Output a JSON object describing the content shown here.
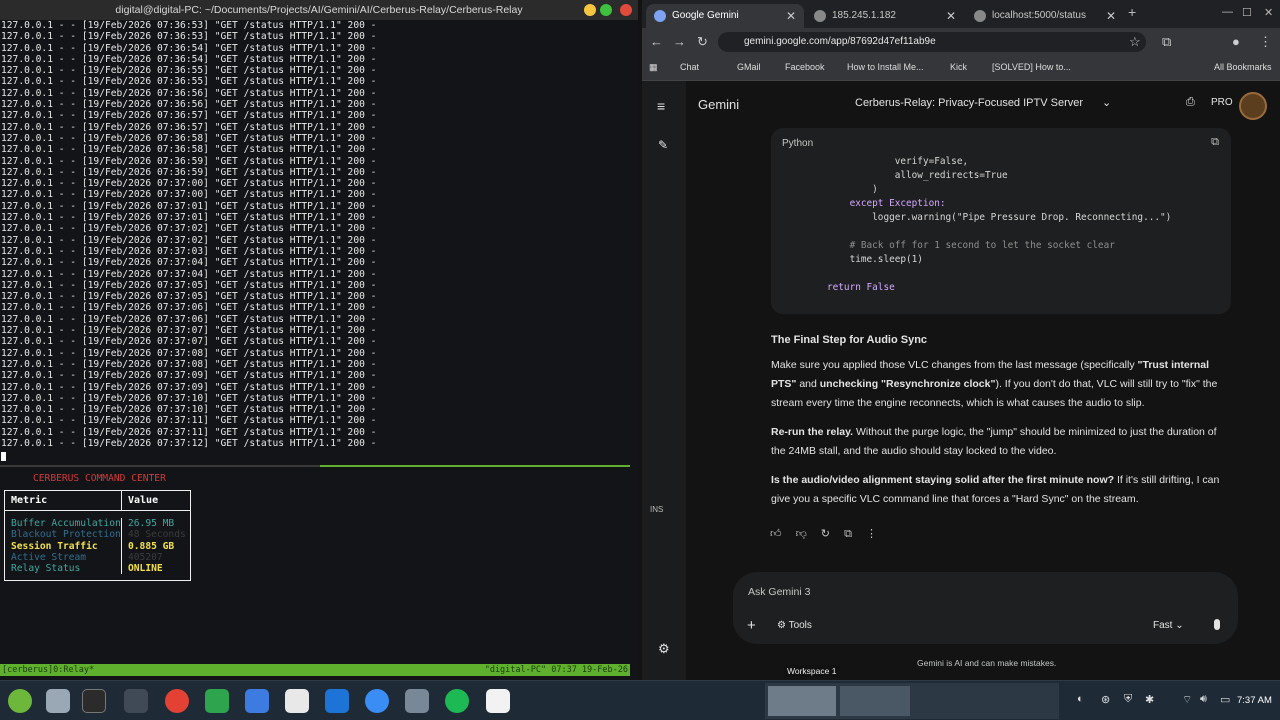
{
  "terminal": {
    "title": "digital@digital-PC: ~/Documents/Projects/AI/Gemini/AI/Cerberus-Relay/Cerberus-Relay",
    "log_lines": [
      "127.0.0.1 - - [19/Feb/2026 07:36:53] \"GET /status HTTP/1.1\" 200 -",
      "127.0.0.1 - - [19/Feb/2026 07:36:53] \"GET /status HTTP/1.1\" 200 -",
      "127.0.0.1 - - [19/Feb/2026 07:36:54] \"GET /status HTTP/1.1\" 200 -",
      "127.0.0.1 - - [19/Feb/2026 07:36:54] \"GET /status HTTP/1.1\" 200 -",
      "127.0.0.1 - - [19/Feb/2026 07:36:55] \"GET /status HTTP/1.1\" 200 -",
      "127.0.0.1 - - [19/Feb/2026 07:36:55] \"GET /status HTTP/1.1\" 200 -",
      "127.0.0.1 - - [19/Feb/2026 07:36:56] \"GET /status HTTP/1.1\" 200 -",
      "127.0.0.1 - - [19/Feb/2026 07:36:56] \"GET /status HTTP/1.1\" 200 -",
      "127.0.0.1 - - [19/Feb/2026 07:36:57] \"GET /status HTTP/1.1\" 200 -",
      "127.0.0.1 - - [19/Feb/2026 07:36:57] \"GET /status HTTP/1.1\" 200 -",
      "127.0.0.1 - - [19/Feb/2026 07:36:58] \"GET /status HTTP/1.1\" 200 -",
      "127.0.0.1 - - [19/Feb/2026 07:36:58] \"GET /status HTTP/1.1\" 200 -",
      "127.0.0.1 - - [19/Feb/2026 07:36:59] \"GET /status HTTP/1.1\" 200 -",
      "127.0.0.1 - - [19/Feb/2026 07:36:59] \"GET /status HTTP/1.1\" 200 -",
      "127.0.0.1 - - [19/Feb/2026 07:37:00] \"GET /status HTTP/1.1\" 200 -",
      "127.0.0.1 - - [19/Feb/2026 07:37:00] \"GET /status HTTP/1.1\" 200 -",
      "127.0.0.1 - - [19/Feb/2026 07:37:01] \"GET /status HTTP/1.1\" 200 -",
      "127.0.0.1 - - [19/Feb/2026 07:37:01] \"GET /status HTTP/1.1\" 200 -",
      "127.0.0.1 - - [19/Feb/2026 07:37:02] \"GET /status HTTP/1.1\" 200 -",
      "127.0.0.1 - - [19/Feb/2026 07:37:02] \"GET /status HTTP/1.1\" 200 -",
      "127.0.0.1 - - [19/Feb/2026 07:37:03] \"GET /status HTTP/1.1\" 200 -",
      "127.0.0.1 - - [19/Feb/2026 07:37:04] \"GET /status HTTP/1.1\" 200 -",
      "127.0.0.1 - - [19/Feb/2026 07:37:04] \"GET /status HTTP/1.1\" 200 -",
      "127.0.0.1 - - [19/Feb/2026 07:37:05] \"GET /status HTTP/1.1\" 200 -",
      "127.0.0.1 - - [19/Feb/2026 07:37:05] \"GET /status HTTP/1.1\" 200 -",
      "127.0.0.1 - - [19/Feb/2026 07:37:06] \"GET /status HTTP/1.1\" 200 -",
      "127.0.0.1 - - [19/Feb/2026 07:37:06] \"GET /status HTTP/1.1\" 200 -",
      "127.0.0.1 - - [19/Feb/2026 07:37:07] \"GET /status HTTP/1.1\" 200 -",
      "127.0.0.1 - - [19/Feb/2026 07:37:07] \"GET /status HTTP/1.1\" 200 -",
      "127.0.0.1 - - [19/Feb/2026 07:37:08] \"GET /status HTTP/1.1\" 200 -",
      "127.0.0.1 - - [19/Feb/2026 07:37:08] \"GET /status HTTP/1.1\" 200 -",
      "127.0.0.1 - - [19/Feb/2026 07:37:09] \"GET /status HTTP/1.1\" 200 -",
      "127.0.0.1 - - [19/Feb/2026 07:37:09] \"GET /status HTTP/1.1\" 200 -",
      "127.0.0.1 - - [19/Feb/2026 07:37:10] \"GET /status HTTP/1.1\" 200 -",
      "127.0.0.1 - - [19/Feb/2026 07:37:10] \"GET /status HTTP/1.1\" 200 -",
      "127.0.0.1 - - [19/Feb/2026 07:37:11] \"GET /status HTTP/1.1\" 200 -",
      "127.0.0.1 - - [19/Feb/2026 07:37:11] \"GET /status HTTP/1.1\" 200 -",
      "127.0.0.1 - - [19/Feb/2026 07:37:12] \"GET /status HTTP/1.1\" 200 -"
    ],
    "command_center": {
      "title": "CERBERUS COMMAND CENTER",
      "col_metric": "Metric",
      "col_value": "Value",
      "rows": [
        {
          "metric": "Buffer Accumulation",
          "value": "26.95 MB",
          "metric_color": "#3fa7a0",
          "value_color": "#3fa7a0"
        },
        {
          "metric": "Blackout Protection",
          "value": "48 Seconds",
          "metric_color": "#2f6f8f",
          "value_color": "#3b3b3b"
        },
        {
          "metric": "Session Traffic",
          "value": "0.885 GB",
          "metric_color": "#f2e14a",
          "value_color": "#f2e14a"
        },
        {
          "metric": "Active Stream",
          "value": "405207",
          "metric_color": "#2f6f8f",
          "value_color": "#3b3b3b"
        },
        {
          "metric": "Relay Status",
          "value": "ONLINE",
          "metric_color": "#3fa7a0",
          "value_color": "#f2e14a"
        }
      ]
    },
    "status_left": "[cerberus]0:Relay*",
    "status_right": "\"digital-PC\" 07:37 19-Feb-26"
  },
  "browser": {
    "tabs": [
      {
        "label": "Google Gemini",
        "active": true
      },
      {
        "label": "185.245.1.182",
        "active": false
      },
      {
        "label": "localhost:5000/status",
        "active": false
      }
    ],
    "url": "gemini.google.com/app/87692d47ef11ab9e",
    "bookmarks": [
      "Chat",
      "GMail",
      "Facebook",
      "How to Install Me...",
      "Kick",
      "[SOLVED] How to...",
      "All Bookmarks"
    ]
  },
  "gemini": {
    "app_name": "Gemini",
    "chat_title": "Cerberus-Relay: Privacy-Focused IPTV Server",
    "plan_badge": "PRO",
    "code_lang": "Python",
    "code_lines": [
      "            verify=False,",
      "            allow_redirects=True",
      "        )",
      "    except Exception:",
      "        logger.warning(\"Pipe Pressure Drop. Reconnecting...\")",
      "",
      "    # Back off for 1 second to let the socket clear",
      "    time.sleep(1)",
      "",
      "return False"
    ],
    "heading": "The Final Step for Audio Sync",
    "p1_a": "Make sure you applied those VLC changes from the last message (specifically ",
    "p1_b": "\"Trust internal PTS\"",
    "p1_c": " and ",
    "p1_d": "unchecking \"Resynchronize clock\"",
    "p1_e": "). If you don't do that, VLC will still try to \"fix\" the stream every time the engine reconnects, which is what causes the audio to slip.",
    "p2_a": "Re-run the relay.",
    "p2_b": " Without the purge logic, the \"jump\" should be minimized to just the duration of the 24MB stall, and the audio should stay locked to the video.",
    "p3_a": "Is the audio/video alignment staying solid after the first minute now?",
    "p3_b": " If it's still drifting, I can give you a specific VLC command line that forces a \"Hard Sync\" on the stream.",
    "input_placeholder": "Ask Gemini 3",
    "tools_label": "Tools",
    "mode_label": "Fast",
    "disclaimer": "Gemini is AI and can make mistakes.",
    "rail_badge": "INS"
  },
  "taskbar": {
    "workspace_label": "Workspace 1",
    "clock": "7:37 AM"
  },
  "colors": {
    "accent_green": "#5fb02d",
    "terminal_bg": "#131418",
    "gemini_bg": "#131314"
  }
}
